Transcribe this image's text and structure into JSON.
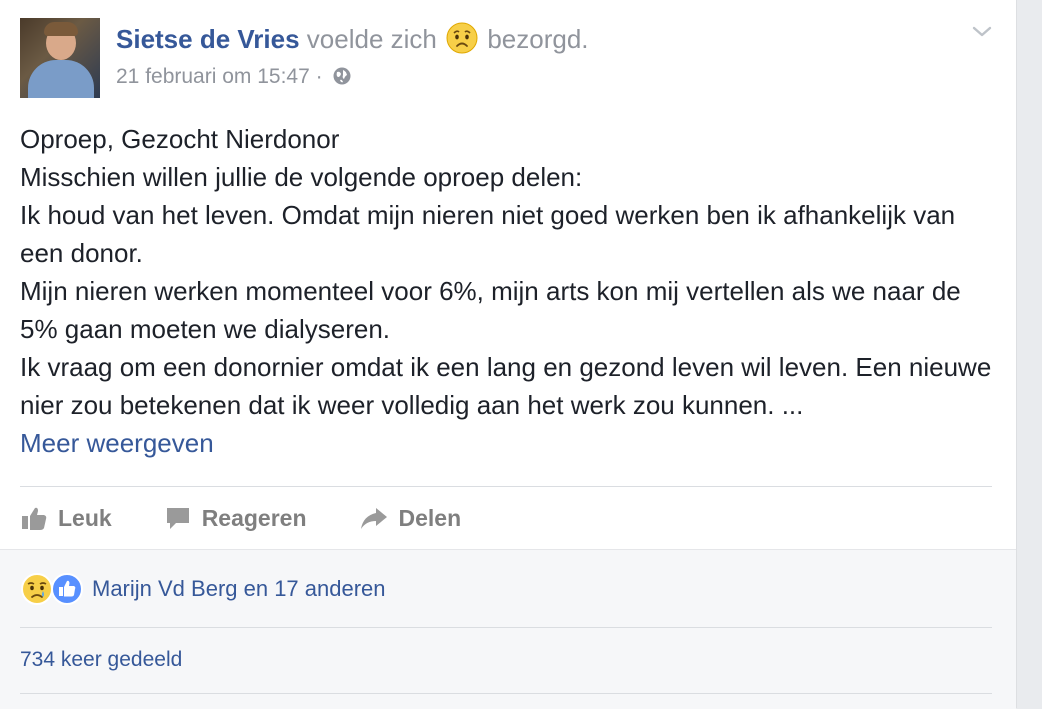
{
  "post": {
    "author": "Sietse de Vries",
    "feeling_prefix": "voelde zich",
    "feeling_text": "bezorgd.",
    "feeling_icon": "worried-face-icon",
    "timestamp": "21 februari om 15:47",
    "separator": "·",
    "privacy_icon": "globe-icon",
    "body": [
      "Oproep, Gezocht Nierdonor",
      "Misschien willen jullie de volgende oproep delen:",
      "Ik houd van het leven. Omdat mijn nieren niet goed werken ben ik afhankelijk van een donor.",
      "Mijn nieren werken momenteel voor 6%, mijn arts kon mij vertellen als we naar de 5% gaan moeten we dialyseren.",
      "Ik vraag om een donornier omdat ik een lang en gezond leven wil leven. Een nieuwe nier zou betekenen dat ik weer volledig aan het werk zou kunnen. ..."
    ],
    "more_link": "Meer weergeven"
  },
  "actions": {
    "like": "Leuk",
    "comment": "Reageren",
    "share": "Delen"
  },
  "footer": {
    "reactions_text": "Marijn Vd Berg en 17 anderen",
    "reaction_icons": [
      "sad-face-icon",
      "like-thumb-icon"
    ],
    "shares_text": "734 keer gedeeld"
  },
  "colors": {
    "link": "#365899",
    "text": "#1d2129",
    "muted": "#90949c",
    "action": "#7f7f7f",
    "like_blue": "#5890ff",
    "emoji_yellow": "#f7cf48"
  }
}
